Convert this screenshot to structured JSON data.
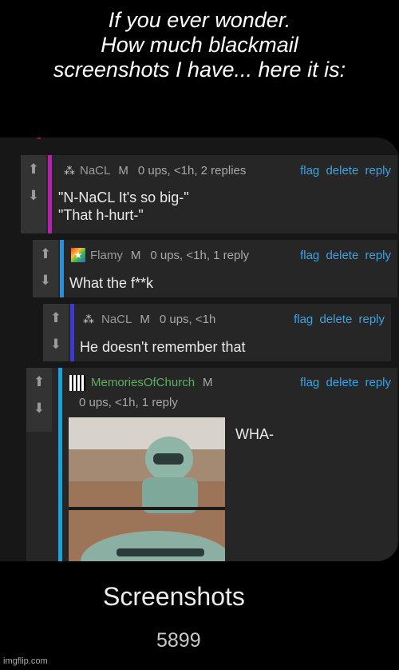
{
  "caption": {
    "line1": "If you ever wonder.",
    "line2": "How much blackmail",
    "line3": "screenshots I have... here it is:"
  },
  "comments": [
    {
      "user": "NaCL",
      "badge": "M",
      "info": "0 ups, <1h, 2 replies",
      "body_lines": [
        "\"N-NaCL It's so big-\"",
        "\"That h-hurt-\""
      ],
      "accent": "#b71fb0"
    },
    {
      "user": "Flamy",
      "badge": "M",
      "info": "0 ups, <1h, 1 reply",
      "body_lines": [
        "What the f**k"
      ],
      "accent": "#2a8fd6"
    },
    {
      "user": "NaCL",
      "badge": "M",
      "info": "0 ups, <1h",
      "body_lines": [
        "He doesn't remember that"
      ],
      "accent": "#3a3ad0"
    },
    {
      "user": "MemoriesOfChurch",
      "badge": "M",
      "info": "0 ups, <1h, 1 reply",
      "body_lines": [
        "WHA-"
      ],
      "accent": "#1aa3d8"
    }
  ],
  "actions": {
    "flag": "flag",
    "delete": "delete",
    "reply": "reply"
  },
  "footer": {
    "title": "Screenshots",
    "count": "5899"
  },
  "watermark": "imgflip.com",
  "icons": {
    "upvote": "arrow-up-icon",
    "downvote": "arrow-down-icon"
  }
}
